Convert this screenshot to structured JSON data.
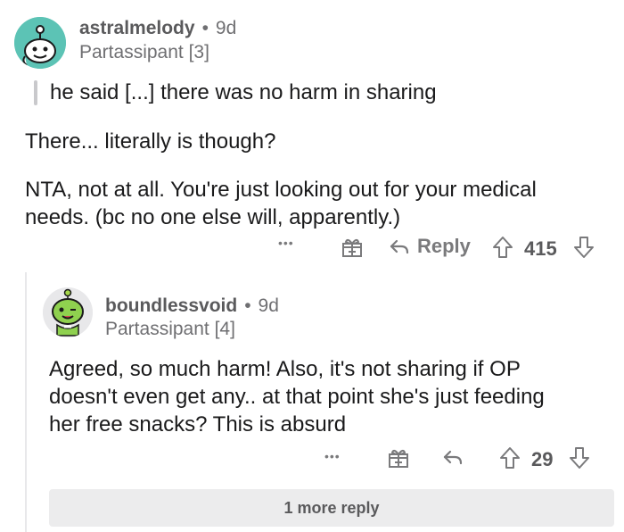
{
  "comment": {
    "username": "astralmelody",
    "separator": "•",
    "time": "9d",
    "flair": "Partassipant [3]",
    "quote": "he said [...] there was no harm in sharing",
    "paragraph1": "There... literally is though?",
    "paragraph2_line1": "NTA, not at all. You're just looking out for your medical",
    "paragraph2_line2": "needs. (bc no one else will, apparently.)",
    "actions": {
      "more": "•••",
      "reply_label": "Reply",
      "score": "415"
    }
  },
  "reply": {
    "username": "boundlessvoid",
    "separator": "•",
    "time": "9d",
    "flair": "Partassipant [4]",
    "line1": "Agreed, so much harm! Also, it's not sharing if OP",
    "line2": "doesn't even get any.. at that point she's just feeding",
    "line3": "her free snacks? This is absurd",
    "actions": {
      "more": "•••",
      "score": "29"
    }
  },
  "more_replies": "1 more reply",
  "colors": {
    "avatar1_bg": "#5cc3b5",
    "avatar2_bg": "#e8e8ea",
    "text_muted": "#7a7a7c"
  }
}
